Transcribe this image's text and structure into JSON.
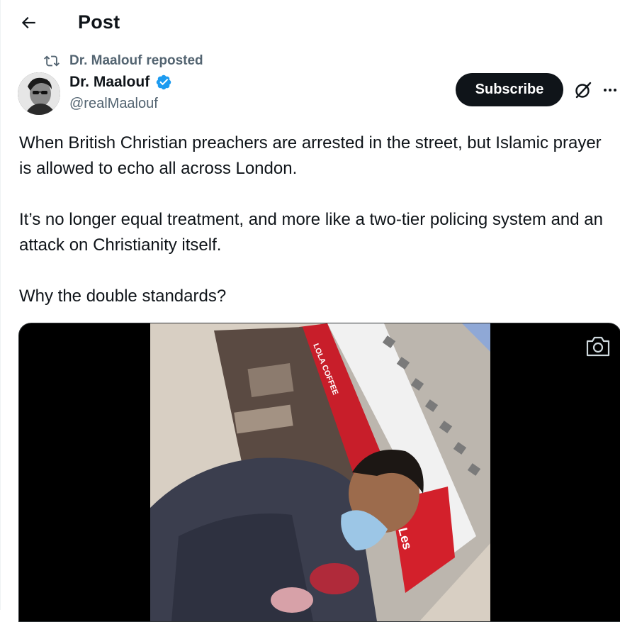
{
  "header": {
    "title": "Post",
    "back_icon": "arrow-left-icon"
  },
  "repost": {
    "icon": "repost-icon",
    "name": "Dr. Maalouf",
    "label": "reposted"
  },
  "author": {
    "name": "Dr. Maalouf",
    "handle": "@realMaalouf",
    "verified_icon": "verified-badge-icon",
    "verified_color": "#1d9bf0"
  },
  "actions": {
    "subscribe_label": "Subscribe",
    "grok_icon": "grok-icon",
    "more_icon": "more-icon"
  },
  "post": {
    "paragraphs": [
      "When British Christian preachers are arrested in the street, but Islamic prayer is allowed to echo all across London.",
      "It’s no longer equal treatment, and more like a two-tier policing system and an attack on Christianity itself.",
      "Why the double standards?"
    ]
  },
  "media": {
    "type": "video",
    "camera_icon": "camera-icon",
    "sign_text_1": "LOLA COFFEE",
    "sign_text_2": "Les"
  },
  "colors": {
    "text_primary": "#0f1419",
    "text_secondary": "#536471",
    "accent": "#1d9bf0",
    "button_dark": "#0f1419"
  }
}
